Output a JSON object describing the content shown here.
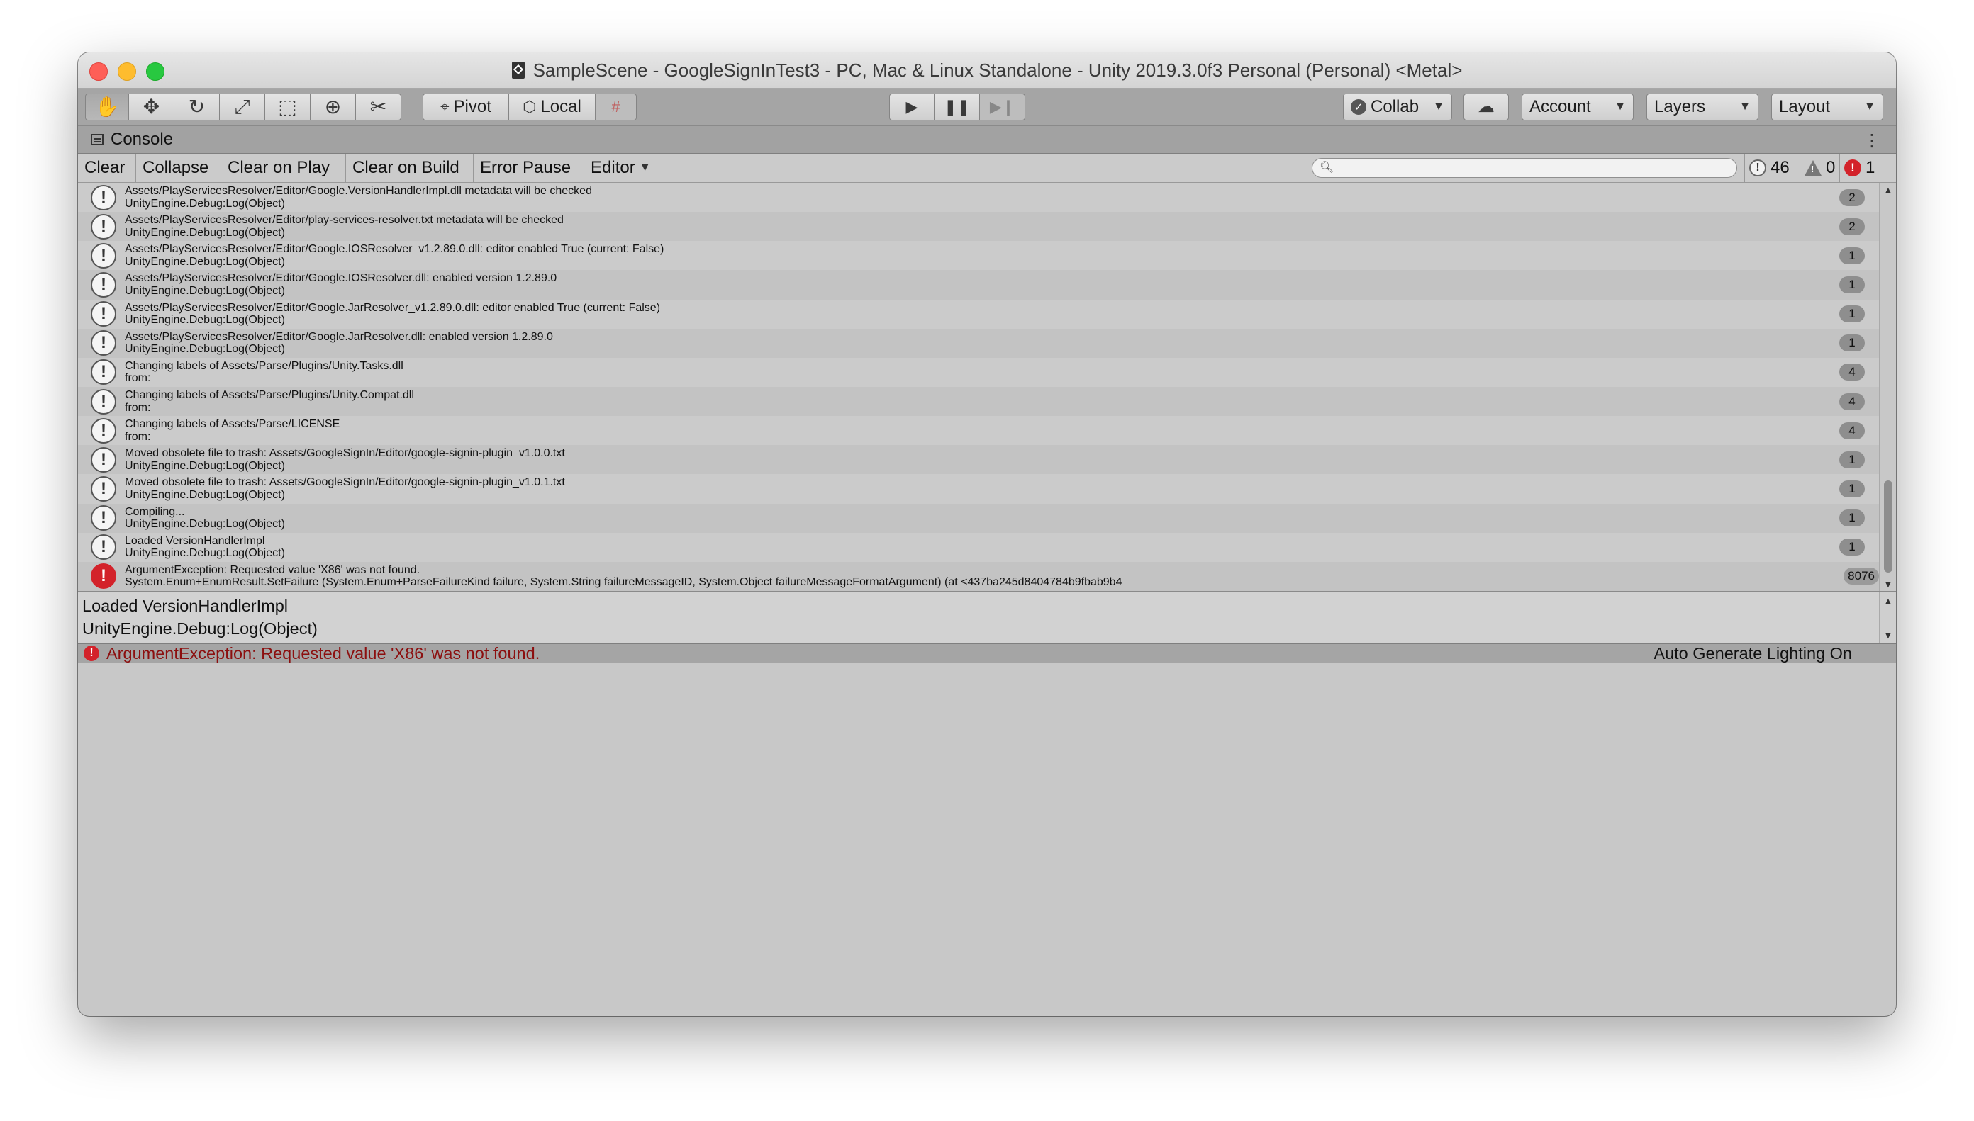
{
  "window": {
    "title": "SampleScene - GoogleSignInTest3 - PC, Mac & Linux Standalone - Unity 2019.3.0f3 Personal (Personal) <Metal>"
  },
  "toolbar": {
    "pivot_label": "Pivot",
    "local_label": "Local",
    "collab_label": "Collab",
    "account_label": "Account",
    "layers_label": "Layers",
    "layout_label": "Layout"
  },
  "console": {
    "tab_label": "Console",
    "buttons": {
      "clear": "Clear",
      "collapse": "Collapse",
      "clear_on_play": "Clear on Play",
      "clear_on_build": "Clear on Build",
      "error_pause": "Error Pause",
      "editor": "Editor"
    },
    "search_placeholder": "",
    "counts": {
      "info": "46",
      "warnings": "0",
      "errors": "1"
    },
    "entries": [
      {
        "type": "info",
        "line1": "Assets/PlayServicesResolver/Editor/Google.VersionHandlerImpl.dll metadata will be checked",
        "line2": "UnityEngine.Debug:Log(Object)",
        "count": "2"
      },
      {
        "type": "info",
        "line1": "Assets/PlayServicesResolver/Editor/play-services-resolver.txt metadata will be checked",
        "line2": "UnityEngine.Debug:Log(Object)",
        "count": "2"
      },
      {
        "type": "info",
        "line1": "Assets/PlayServicesResolver/Editor/Google.IOSResolver_v1.2.89.0.dll: editor enabled True (current: False)",
        "line2": "UnityEngine.Debug:Log(Object)",
        "count": "1"
      },
      {
        "type": "info",
        "line1": "Assets/PlayServicesResolver/Editor/Google.IOSResolver.dll: enabled version 1.2.89.0",
        "line2": "UnityEngine.Debug:Log(Object)",
        "count": "1"
      },
      {
        "type": "info",
        "line1": "Assets/PlayServicesResolver/Editor/Google.JarResolver_v1.2.89.0.dll: editor enabled True (current: False)",
        "line2": "UnityEngine.Debug:Log(Object)",
        "count": "1"
      },
      {
        "type": "info",
        "line1": "Assets/PlayServicesResolver/Editor/Google.JarResolver.dll: enabled version 1.2.89.0",
        "line2": "UnityEngine.Debug:Log(Object)",
        "count": "1"
      },
      {
        "type": "info",
        "line1": "Changing labels of Assets/Parse/Plugins/Unity.Tasks.dll",
        "line2": "from:",
        "count": "4"
      },
      {
        "type": "info",
        "line1": "Changing labels of Assets/Parse/Plugins/Unity.Compat.dll",
        "line2": "from:",
        "count": "4"
      },
      {
        "type": "info",
        "line1": "Changing labels of Assets/Parse/LICENSE",
        "line2": "from:",
        "count": "4"
      },
      {
        "type": "info",
        "line1": "Moved obsolete file to trash: Assets/GoogleSignIn/Editor/google-signin-plugin_v1.0.0.txt",
        "line2": "UnityEngine.Debug:Log(Object)",
        "count": "1"
      },
      {
        "type": "info",
        "line1": "Moved obsolete file to trash: Assets/GoogleSignIn/Editor/google-signin-plugin_v1.0.1.txt",
        "line2": "UnityEngine.Debug:Log(Object)",
        "count": "1"
      },
      {
        "type": "info",
        "line1": "Compiling...",
        "line2": "UnityEngine.Debug:Log(Object)",
        "count": "1"
      },
      {
        "type": "info",
        "line1": "Loaded VersionHandlerImpl",
        "line2": "UnityEngine.Debug:Log(Object)",
        "count": "1"
      },
      {
        "type": "error",
        "line1": "ArgumentException: Requested value 'X86' was not found.",
        "line2": "System.Enum+EnumResult.SetFailure (System.Enum+ParseFailureKind failure, System.String failureMessageID, System.Object failureMessageFormatArgument) (at <437ba245d8404784b9fbab9b4",
        "count": "8076"
      }
    ],
    "detail": {
      "line1": "Loaded VersionHandlerImpl",
      "line2": "UnityEngine.Debug:Log(Object)"
    }
  },
  "statusbar": {
    "message": "ArgumentException: Requested value 'X86' was not found.",
    "right_text": "Auto Generate Lighting On"
  },
  "icons": {
    "tools": [
      "hand-tool-icon",
      "move-tool-icon",
      "rotate-tool-icon",
      "scale-tool-icon",
      "rect-tool-icon",
      "transform-tool-icon",
      "custom-tool-icon"
    ],
    "play": "play-icon",
    "pause": "pause-icon",
    "step": "step-icon",
    "cloud": "cloud-icon"
  },
  "colors": {
    "error_red": "#d3222a",
    "status_error_text": "#8c0f0f",
    "window_bg": "#c8c8c8"
  }
}
